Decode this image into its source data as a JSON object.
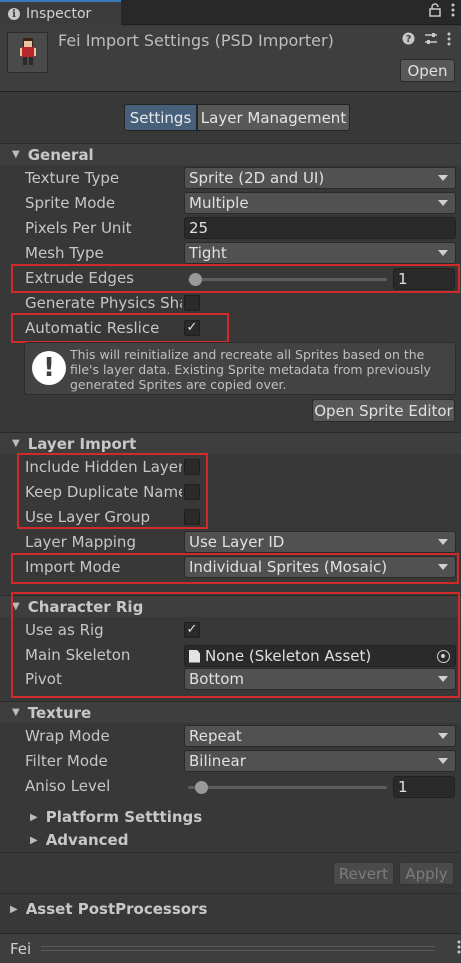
{
  "tab": {
    "title": "Inspector"
  },
  "header": {
    "title": "Fei Import Settings (PSD Importer)",
    "open_button": "Open"
  },
  "toolbar": {
    "tabs": [
      "Settings",
      "Layer Management"
    ],
    "active": 0
  },
  "general": {
    "header": "General",
    "texture_type": {
      "label": "Texture Type",
      "value": "Sprite (2D and UI)"
    },
    "sprite_mode": {
      "label": "Sprite Mode",
      "value": "Multiple"
    },
    "pixels_per_unit": {
      "label": "Pixels Per Unit",
      "value": "25"
    },
    "mesh_type": {
      "label": "Mesh Type",
      "value": "Tight"
    },
    "extrude_edges": {
      "label": "Extrude Edges",
      "value": "1",
      "fraction": 0.04
    },
    "generate_physics": {
      "label": "Generate Physics Shape",
      "checked": false
    },
    "automatic_reslice": {
      "label": "Automatic Reslice",
      "checked": true
    },
    "help_text": "This will reinitialize and recreate all Sprites based on the file's layer data. Existing Sprite metadata from previously generated Sprites are copied over.",
    "open_sprite_editor": "Open Sprite Editor"
  },
  "layer_import": {
    "header": "Layer Import",
    "include_hidden": {
      "label": "Include Hidden Layers",
      "checked": false
    },
    "keep_duplicate": {
      "label": "Keep Duplicate Name",
      "checked": false
    },
    "use_layer_group": {
      "label": "Use Layer Group",
      "checked": false
    },
    "layer_mapping": {
      "label": "Layer Mapping",
      "value": "Use Layer ID"
    },
    "import_mode": {
      "label": "Import Mode",
      "value": "Individual Sprites (Mosaic)"
    }
  },
  "character_rig": {
    "header": "Character Rig",
    "use_as_rig": {
      "label": "Use as Rig",
      "checked": true
    },
    "main_skeleton": {
      "label": "Main Skeleton",
      "value": "None (Skeleton Asset)"
    },
    "pivot": {
      "label": "Pivot",
      "value": "Bottom"
    }
  },
  "texture": {
    "header": "Texture",
    "wrap_mode": {
      "label": "Wrap Mode",
      "value": "Repeat"
    },
    "filter_mode": {
      "label": "Filter Mode",
      "value": "Bilinear"
    },
    "aniso_level": {
      "label": "Aniso Level",
      "value": "1",
      "fraction": 0.06
    }
  },
  "platform_settings": "Platform Setttings",
  "advanced": "Advanced",
  "buttons": {
    "revert": "Revert",
    "apply": "Apply"
  },
  "asset_postprocessors": "Asset PostProcessors",
  "footer": {
    "asset_name": "Fei"
  },
  "colors": {
    "highlight": "#d12a2a",
    "active_tab": "#46607c",
    "tab_accent": "#3a79bb"
  }
}
